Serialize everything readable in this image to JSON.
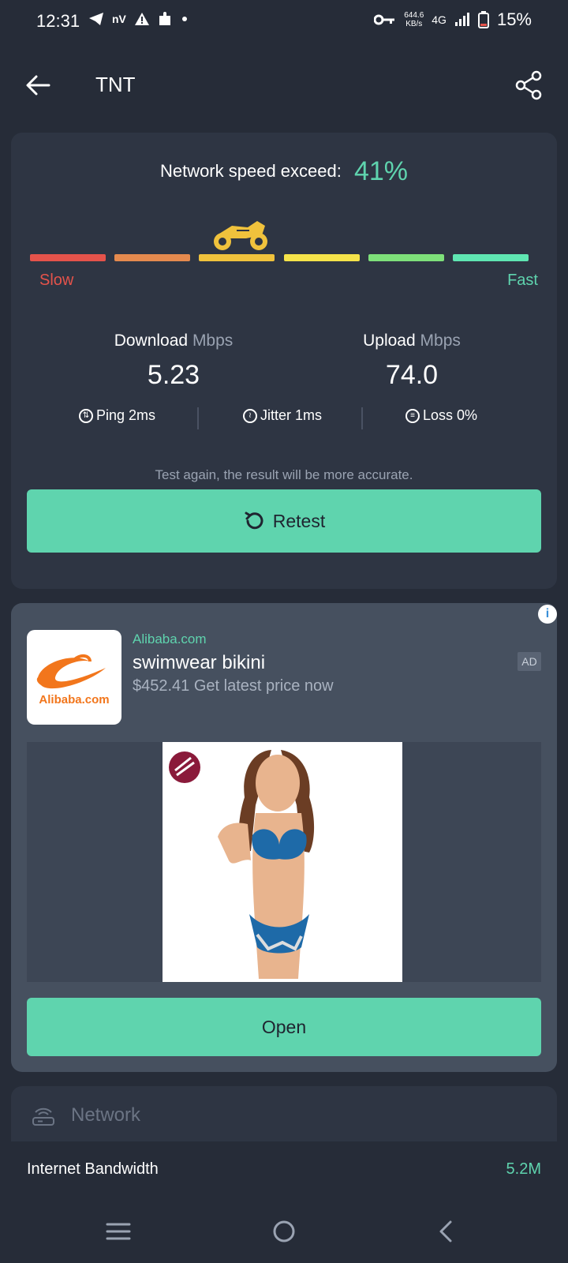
{
  "status_bar": {
    "time": "12:31",
    "left_glyphs": "nV",
    "net_speed_value": "644.6",
    "net_speed_unit": "KB/s",
    "network": "4G",
    "battery": "15%"
  },
  "app_bar": {
    "title": "TNT"
  },
  "result": {
    "exceed_label": "Network speed exceed:",
    "exceed_value": "41%",
    "gauge": {
      "slow_label": "Slow",
      "fast_label": "Fast",
      "segment_colors": [
        "#e5534b",
        "#e58a4e",
        "#f0c23c",
        "#f5e34a",
        "#7ee07a",
        "#5fe6b2"
      ],
      "active_segment": 3
    },
    "download": {
      "label": "Download",
      "unit": "Mbps",
      "value": "5.23"
    },
    "upload": {
      "label": "Upload",
      "unit": "Mbps",
      "value": "74.0"
    },
    "ping": "Ping 2ms",
    "jitter": "Jitter 1ms",
    "loss": "Loss 0%",
    "hint": "Test again, the result will be more accurate.",
    "retest_label": "Retest"
  },
  "ad": {
    "source": "Alibaba.com",
    "title": "swimwear bikini",
    "subtitle": "$452.41 Get latest price now",
    "badge": "AD",
    "logo_text": "Alibaba.com",
    "open_label": "Open"
  },
  "network": {
    "header": "Network",
    "rows": [
      {
        "label": "Internet Bandwidth",
        "value": "5.2M"
      }
    ]
  },
  "colors": {
    "accent": "#5fd4ae",
    "background": "#262c38",
    "card": "#2e3543"
  }
}
